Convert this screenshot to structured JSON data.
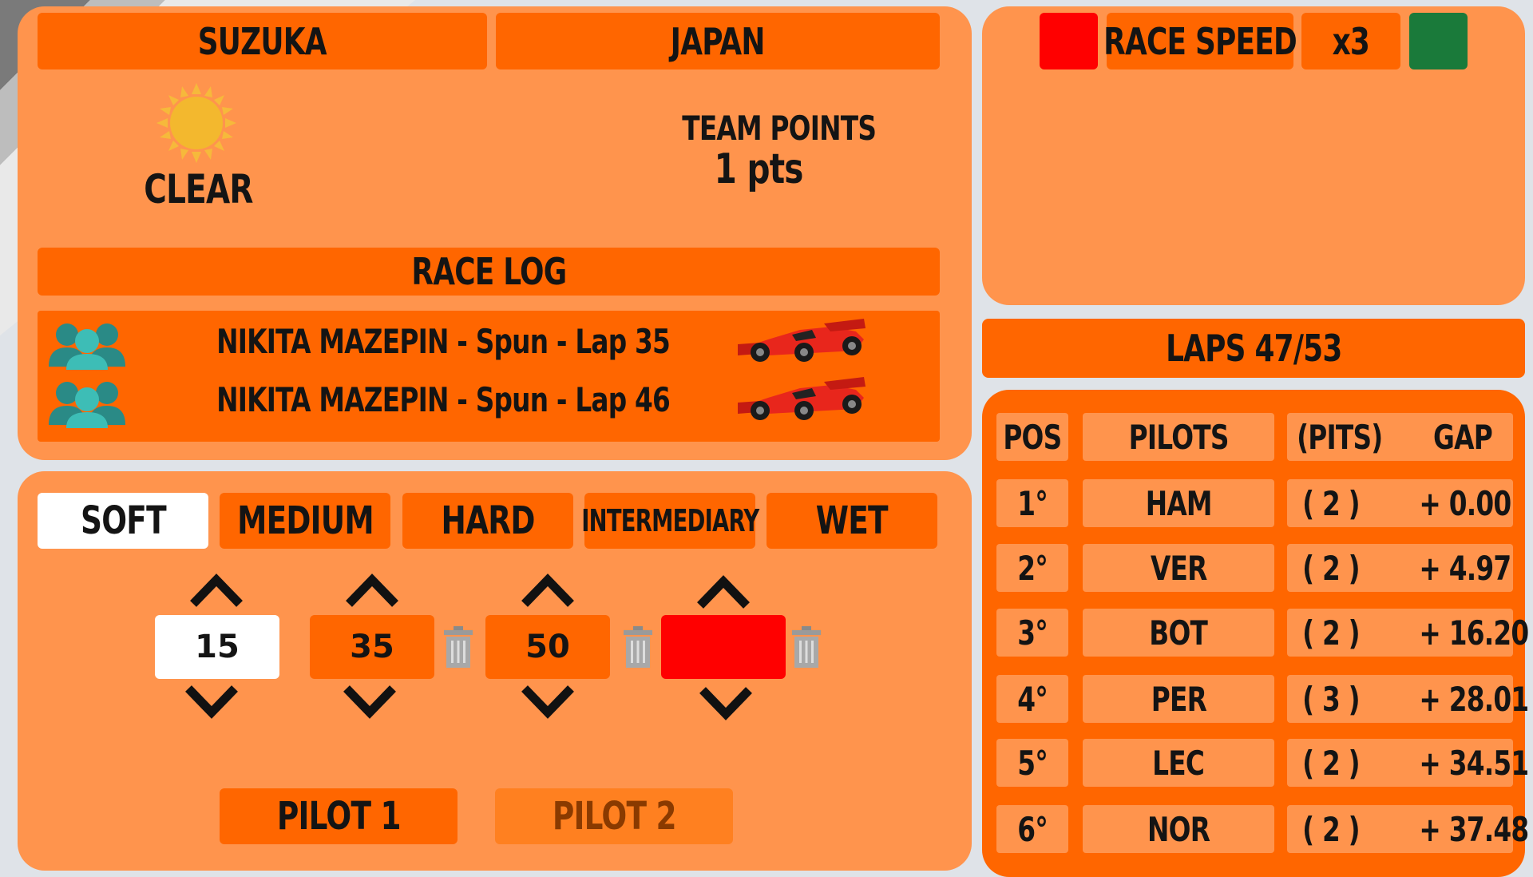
{
  "track": {
    "circuit": "SUZUKA",
    "country": "JAPAN"
  },
  "weather": {
    "icon": "sun-icon",
    "label": "CLEAR"
  },
  "team_points": {
    "title": "TEAM POINTS",
    "value": "1 pts"
  },
  "race_log": {
    "title": "RACE LOG",
    "entries": [
      {
        "text": "NIKITA MAZEPIN - Spun - Lap 35",
        "icon": "people-icon",
        "car": "f1-car-icon"
      },
      {
        "text": "NIKITA MAZEPIN - Spun - Lap 46",
        "icon": "people-icon",
        "car": "f1-car-icon"
      }
    ]
  },
  "tyres": {
    "tabs": [
      "SOFT",
      "MEDIUM",
      "HARD",
      "INTERMEDIARY",
      "WET"
    ],
    "selected": "SOFT"
  },
  "stints": [
    {
      "value": "15"
    },
    {
      "value": "35"
    },
    {
      "value": "50"
    },
    {
      "value": ""
    }
  ],
  "pilots": {
    "pilot1": "PILOT 1",
    "pilot2": "PILOT 2",
    "selected": "PILOT 1"
  },
  "race_speed": {
    "label": "RACE SPEED",
    "value": "x3",
    "minus_color": "#ff0000",
    "plus_color": "#1a7a3a"
  },
  "laps": {
    "label": "LAPS 47/53"
  },
  "standings": {
    "headers": {
      "pos": "POS",
      "pilots": "PILOTS",
      "pits": "(PITS)",
      "gap": "GAP"
    },
    "rows": [
      {
        "pos": "1°",
        "pilot": "HAM",
        "pits": "( 2 )",
        "gap": "+ 0.00"
      },
      {
        "pos": "2°",
        "pilot": "VER",
        "pits": "( 2 )",
        "gap": "+ 4.97"
      },
      {
        "pos": "3°",
        "pilot": "BOT",
        "pits": "( 2 )",
        "gap": "+ 16.20"
      },
      {
        "pos": "4°",
        "pilot": "PER",
        "pits": "( 3 )",
        "gap": "+ 28.01"
      },
      {
        "pos": "5°",
        "pilot": "LEC",
        "pits": "( 2 )",
        "gap": "+ 34.51"
      },
      {
        "pos": "6°",
        "pilot": "NOR",
        "pits": "( 2 )",
        "gap": "+ 37.48"
      }
    ]
  },
  "colors": {
    "panel": "#ff944d",
    "bar": "#ff6600",
    "accent_red": "#ff0000",
    "accent_green": "#1a7a3a"
  }
}
